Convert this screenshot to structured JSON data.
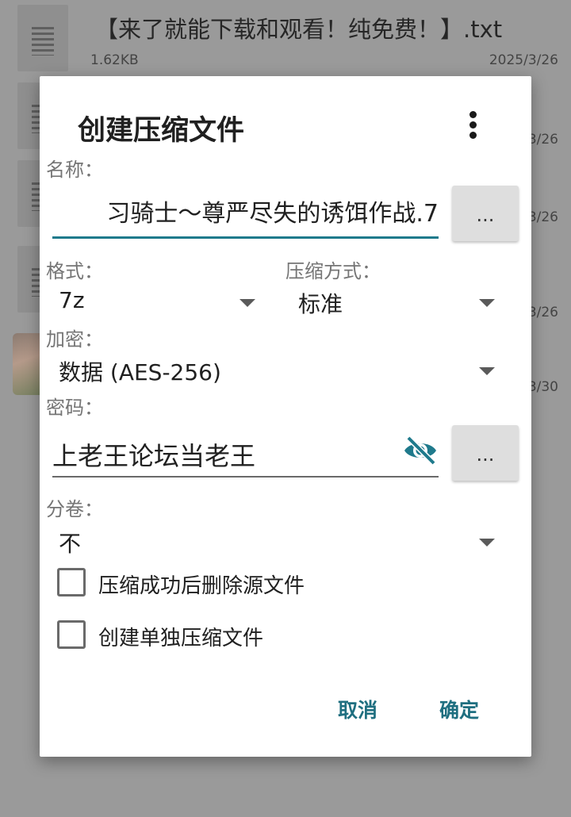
{
  "background": {
    "files": [
      {
        "name": "【来了就能下载和观看！纯免费！】.txt",
        "size": "1.62KB",
        "date": "2025/3/26"
      },
      {
        "name": "",
        "size": "",
        "date": "3/26"
      },
      {
        "name": "",
        "size": "",
        "date": "3/26"
      },
      {
        "name": "",
        "size": "",
        "date": "3/26"
      },
      {
        "name": "",
        "size": "",
        "date": "3/30"
      }
    ]
  },
  "dialog": {
    "title": "创建压缩文件",
    "more_icon": "more-vertical-icon",
    "name_label": "名称：",
    "name_value": "习骑士～尊严尽失的诱饵作战.7",
    "browse_label": "...",
    "format_label": "格式：",
    "format_value": "7z",
    "compression_label": "压缩方式：",
    "compression_value": "标准",
    "encryption_label": "加密：",
    "encryption_value": "数据 (AES-256)",
    "password_label": "密码：",
    "password_value": "上老王论坛当老王",
    "password_eye_icon": "eye-off-icon",
    "password_browse_label": "...",
    "split_label": "分卷：",
    "split_value": "不",
    "options": [
      {
        "label": "压缩成功后删除源文件",
        "checked": false
      },
      {
        "label": "创建单独压缩文件",
        "checked": false
      }
    ],
    "cancel_label": "取消",
    "ok_label": "确定",
    "accent_color": "#1f7a8c"
  }
}
